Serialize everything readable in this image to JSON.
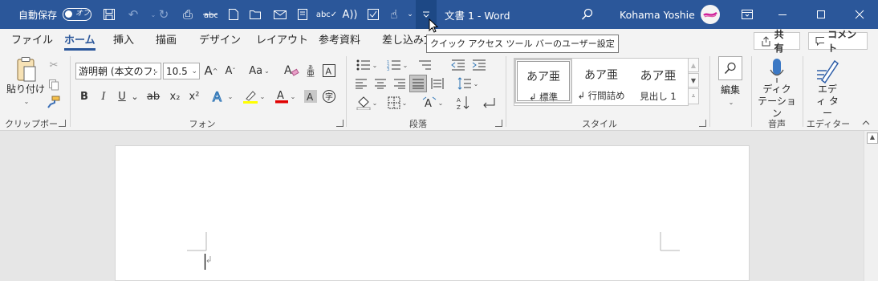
{
  "titlebar": {
    "autosave_label": "自動保存",
    "autosave_state": "オフ",
    "doc_title": "文書 1  -  Word",
    "user_name": "Kohama Yoshie",
    "bg_color": "#2b579a"
  },
  "qat": {
    "icons": [
      "save-icon",
      "undo-icon",
      "redo-icon",
      "print-preview-icon",
      "strikethrough-icon",
      "new-document-icon",
      "open-folder-icon",
      "email-icon",
      "print-icon",
      "spelling-icon",
      "read-aloud-icon",
      "checklist-icon",
      "touch-mode-icon",
      "customize-qat-icon"
    ],
    "tooltip": "クイック アクセス ツール バーのユーザー設定"
  },
  "tabs": [
    "ファイル",
    "ホーム",
    "挿入",
    "描画",
    "デザイン",
    "レイアウト",
    "参考資料",
    "差し込み文"
  ],
  "active_tab": "ホーム",
  "share_label": "共有",
  "comments_label": "コメント",
  "clipboard": {
    "paste_label": "貼り付け",
    "group_label": "クリップボード"
  },
  "font": {
    "font_name": "游明朝 (本文のフ:",
    "font_size": "10.5",
    "grow": "A",
    "shrink": "A",
    "case": "Aa",
    "bold": "B",
    "italic": "I",
    "underline": "U",
    "strike": "ab",
    "subscript": "x₂",
    "superscript": "x²",
    "group_label": "フォント"
  },
  "paragraph": {
    "group_label": "段落"
  },
  "styles": {
    "items": [
      {
        "sample": "あア亜",
        "name": "↲ 標準"
      },
      {
        "sample": "あア亜",
        "name": "↲ 行間詰め"
      },
      {
        "sample": "あア亜",
        "name": "見出し 1"
      }
    ],
    "group_label": "スタイル"
  },
  "editing": {
    "label": "編集"
  },
  "voice": {
    "dictate_label": "ディク テーション",
    "group_label": "音声"
  },
  "editor": {
    "label": "エディ ター",
    "group_label": "エディター"
  }
}
